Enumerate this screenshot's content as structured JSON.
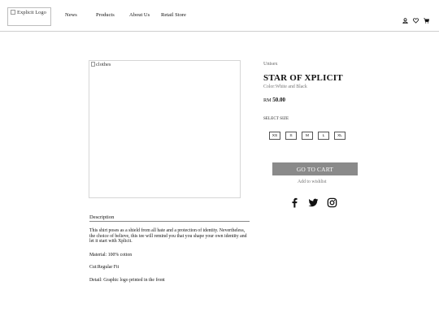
{
  "header": {
    "logo_alt": "Explicit Logo",
    "nav": [
      "News",
      "Products",
      "About Us",
      "Retail Store"
    ]
  },
  "product": {
    "image_alt": "clothes",
    "category": "Unisex",
    "title": "STAR OF XPLICIT",
    "color": "Color:White and Black",
    "currency": "RM",
    "price": "50.00",
    "select_size_label": "SELECT SIZE",
    "sizes": [
      "XS",
      "S",
      "M",
      "L",
      "XL"
    ],
    "cart_button": "GO TO CART",
    "wishlist_link": "Add to wishlist"
  },
  "description": {
    "heading": "Description",
    "body": "This shirt poses as a shield from all hate and a protection of identity. Nevertheless, the choice of believe, this tee will remind you that you shape your own identity and let it start with Xplicit.",
    "material": "Material: 100% cotton",
    "cut": "Cut:Regular Fit",
    "detail": "Detail: Graphic logo printed in the front"
  },
  "icons": {
    "header": [
      "user-icon",
      "heart-icon",
      "cart-icon"
    ],
    "social": [
      "facebook-icon",
      "twitter-icon",
      "instagram-icon"
    ]
  }
}
